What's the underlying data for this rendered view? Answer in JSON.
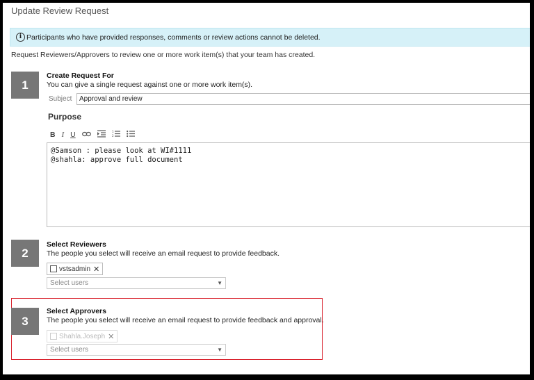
{
  "window": {
    "title": "Update Review Request"
  },
  "info_bar": {
    "text": "Participants who have provided responses, comments or review actions cannot be deleted."
  },
  "intro": "Request Reviewers/Approvers to review one or more work item(s) that your team has created.",
  "step1": {
    "number": "1",
    "title": "Create Request For",
    "description": "You can give a single request against one or more work item(s).",
    "subject_label": "Subject",
    "subject_value": "Approval and review",
    "purpose_label": "Purpose",
    "toolbar": {
      "bold": "B",
      "italic": "I",
      "underline": "U"
    },
    "editor_lines": [
      "@Samson : please look at WI#1111",
      "@shahla: approve full document"
    ]
  },
  "step2": {
    "number": "2",
    "title": "Select Reviewers",
    "description": "The people you select will receive an email request to provide feedback.",
    "chip": "vstsadmin",
    "placeholder": "Select users"
  },
  "step3": {
    "number": "3",
    "title": "Select Approvers",
    "description": "The people you select will receive an email request to provide feedback and approval.",
    "chip": "Shahla.Joseph",
    "placeholder": "Select users"
  },
  "colors": {
    "info_bg": "#d6f1f8",
    "step_bg": "#777777",
    "highlight": "#d9232e"
  },
  "icons": [
    "info-icon",
    "bold-icon",
    "italic-icon",
    "underline-icon",
    "link-icon",
    "indent-icon",
    "numbered-list-icon",
    "bulleted-list-icon",
    "remove-icon",
    "chevron-down-icon"
  ]
}
